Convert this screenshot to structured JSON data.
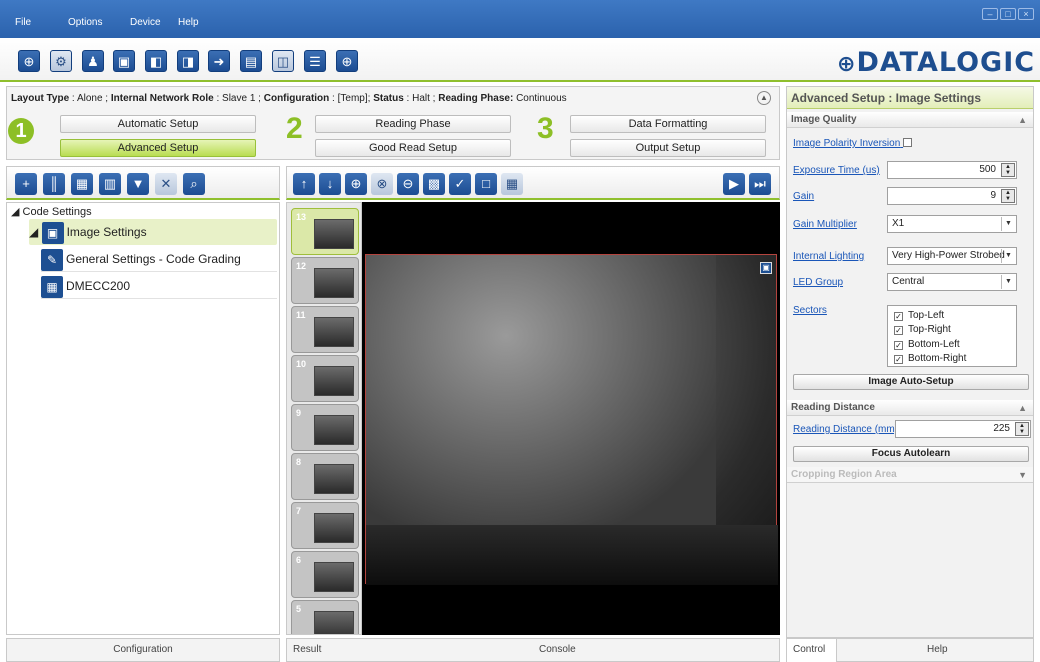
{
  "menu": {
    "items": [
      "File",
      "Options",
      "Device",
      "Help"
    ]
  },
  "brand": {
    "logo_text": "DATALOGIC",
    "accent": "#8dbf26",
    "primary": "#1d4f92"
  },
  "toolbar_icons": [
    "connect-icon",
    "settings-icon",
    "user-icon",
    "window-icon",
    "load-icon",
    "save-icon",
    "send-icon",
    "download-icon",
    "report-icon",
    "statistics-icon",
    "target-icon"
  ],
  "layout": {
    "layout_type_label": "Layout Type",
    "layout_type_value": "Alone",
    "role_label": "Internal Network Role",
    "role_value": "Slave 1",
    "config_label": "Configuration",
    "config_value": "[Temp];",
    "status_label": "Status",
    "status_value": "Halt",
    "phase_label": "Reading Phase:",
    "phase_value": "Continuous"
  },
  "steps": {
    "n1": "1",
    "n2": "2",
    "n3": "3",
    "automatic": "Automatic Setup",
    "advanced": "Advanced Setup",
    "reading_phase": "Reading Phase",
    "good_read": "Good Read Setup",
    "data_formatting": "Data Formatting",
    "output_setup": "Output Setup"
  },
  "tree": {
    "root": "Code Settings",
    "image_settings": "Image Settings",
    "general_settings": "General Settings - Code Grading",
    "dmecc": "DMECC200"
  },
  "left_footer": "Configuration",
  "thumbnails": [
    "13",
    "12",
    "11",
    "10",
    "9",
    "8",
    "7",
    "6",
    "5"
  ],
  "center_footer": {
    "result": "Result",
    "console": "Console"
  },
  "panel": {
    "title": "Advanced Setup : Image Settings",
    "image_quality": "Image Quality",
    "polarity_label": "Image Polarity Inversion",
    "exposure_label": "Exposure Time (us)",
    "exposure_value": "500",
    "gain_label": "Gain",
    "gain_value": "9",
    "gain_mult_label": "Gain Multiplier",
    "gain_mult_value": "X1",
    "lighting_label": "Internal Lighting",
    "lighting_value": "Very High-Power Strobed",
    "led_label": "LED Group",
    "led_value": "Central",
    "sectors_label": "Sectors",
    "sectors": [
      "Top-Left",
      "Top-Right",
      "Bottom-Left",
      "Bottom-Right"
    ],
    "auto_setup": "Image Auto-Setup",
    "reading_distance_section": "Reading Distance",
    "reading_distance_label": "Reading Distance (mm)",
    "reading_distance_value": "225",
    "focus_autolearn": "Focus Autolearn",
    "cropping": "Cropping Region Area"
  },
  "panel_tabs": {
    "control": "Control",
    "help": "Help"
  }
}
